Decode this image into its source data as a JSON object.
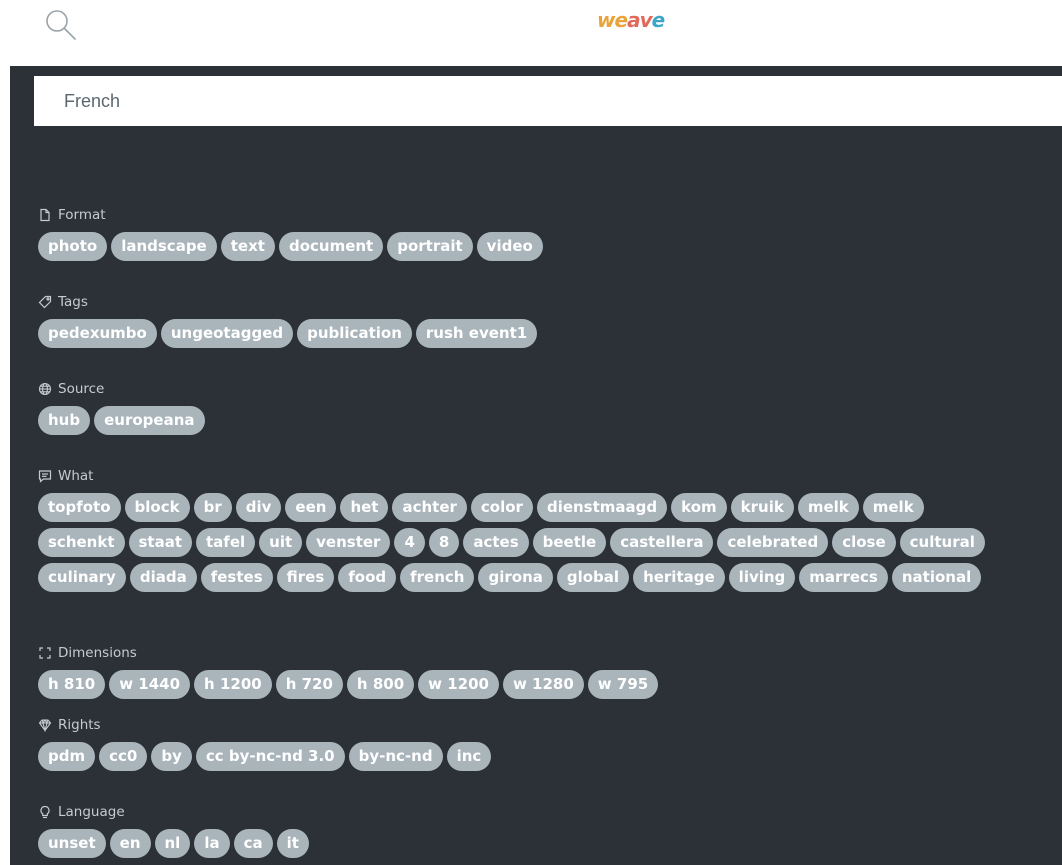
{
  "header": {
    "logo_letters": [
      "w",
      "e",
      "a",
      "v",
      "e"
    ],
    "logo_colors": [
      "#e8a33a",
      "#e8a33a",
      "#e06a5c",
      "#e06a5c",
      "#3aa6c8"
    ]
  },
  "search": {
    "value": "French",
    "icon": "search-icon"
  },
  "facets": [
    {
      "key": "format",
      "title": "Format",
      "icon": "file-icon",
      "color": "#f2c11c",
      "rows": [
        [
          "photo",
          "landscape",
          "text",
          "document",
          "portrait",
          "video"
        ]
      ]
    },
    {
      "key": "tags",
      "title": "Tags",
      "icon": "tag-icon",
      "color": "#e8696b",
      "rows": [
        [
          "pedexumbo",
          "ungeotagged",
          "publication",
          "rush event1"
        ]
      ]
    },
    {
      "key": "source",
      "title": "Source",
      "icon": "globe-icon",
      "color": "#4caf63",
      "rows": [
        [
          "hub",
          "europeana"
        ]
      ]
    },
    {
      "key": "what",
      "title": "What",
      "icon": "comment-icon",
      "color": "#b0b6ba",
      "rows": [
        [
          "topfoto",
          "block",
          "br",
          "div",
          "een",
          "het",
          "achter",
          "color",
          "dienstmaagd",
          "kom",
          "kruik",
          "melk",
          "melk"
        ],
        [
          "schenkt",
          "staat",
          "tafel",
          "uit",
          "venster",
          "4",
          "8",
          "actes",
          "beetle",
          "castellera",
          "celebrated",
          "close",
          "cultural"
        ],
        [
          "culinary",
          "diada",
          "festes",
          "fires",
          "food",
          "french",
          "girona",
          "global",
          "heritage",
          "living",
          "marrecs",
          "national"
        ]
      ]
    },
    {
      "key": "dimensions",
      "title": "Dimensions",
      "icon": "expand-icon",
      "color": "#3fa6cf",
      "rows": [
        [
          "h 810",
          "w 1440",
          "h 1200",
          "h 720",
          "h 800",
          "w 1200",
          "w 1280",
          "w 795"
        ]
      ]
    },
    {
      "key": "rights",
      "title": "Rights",
      "icon": "diamond-icon",
      "color": "#e8696b",
      "rows": [
        [
          "pdm",
          "cc0",
          "by",
          "cc by-nc-nd 3.0",
          "by-nc-nd",
          "inc"
        ]
      ]
    },
    {
      "key": "language",
      "title": "Language",
      "icon": "lightbulb-icon",
      "color": "#e8696b",
      "rows": [
        [
          "unset",
          "en",
          "nl",
          "la",
          "ca",
          "it"
        ]
      ]
    }
  ]
}
